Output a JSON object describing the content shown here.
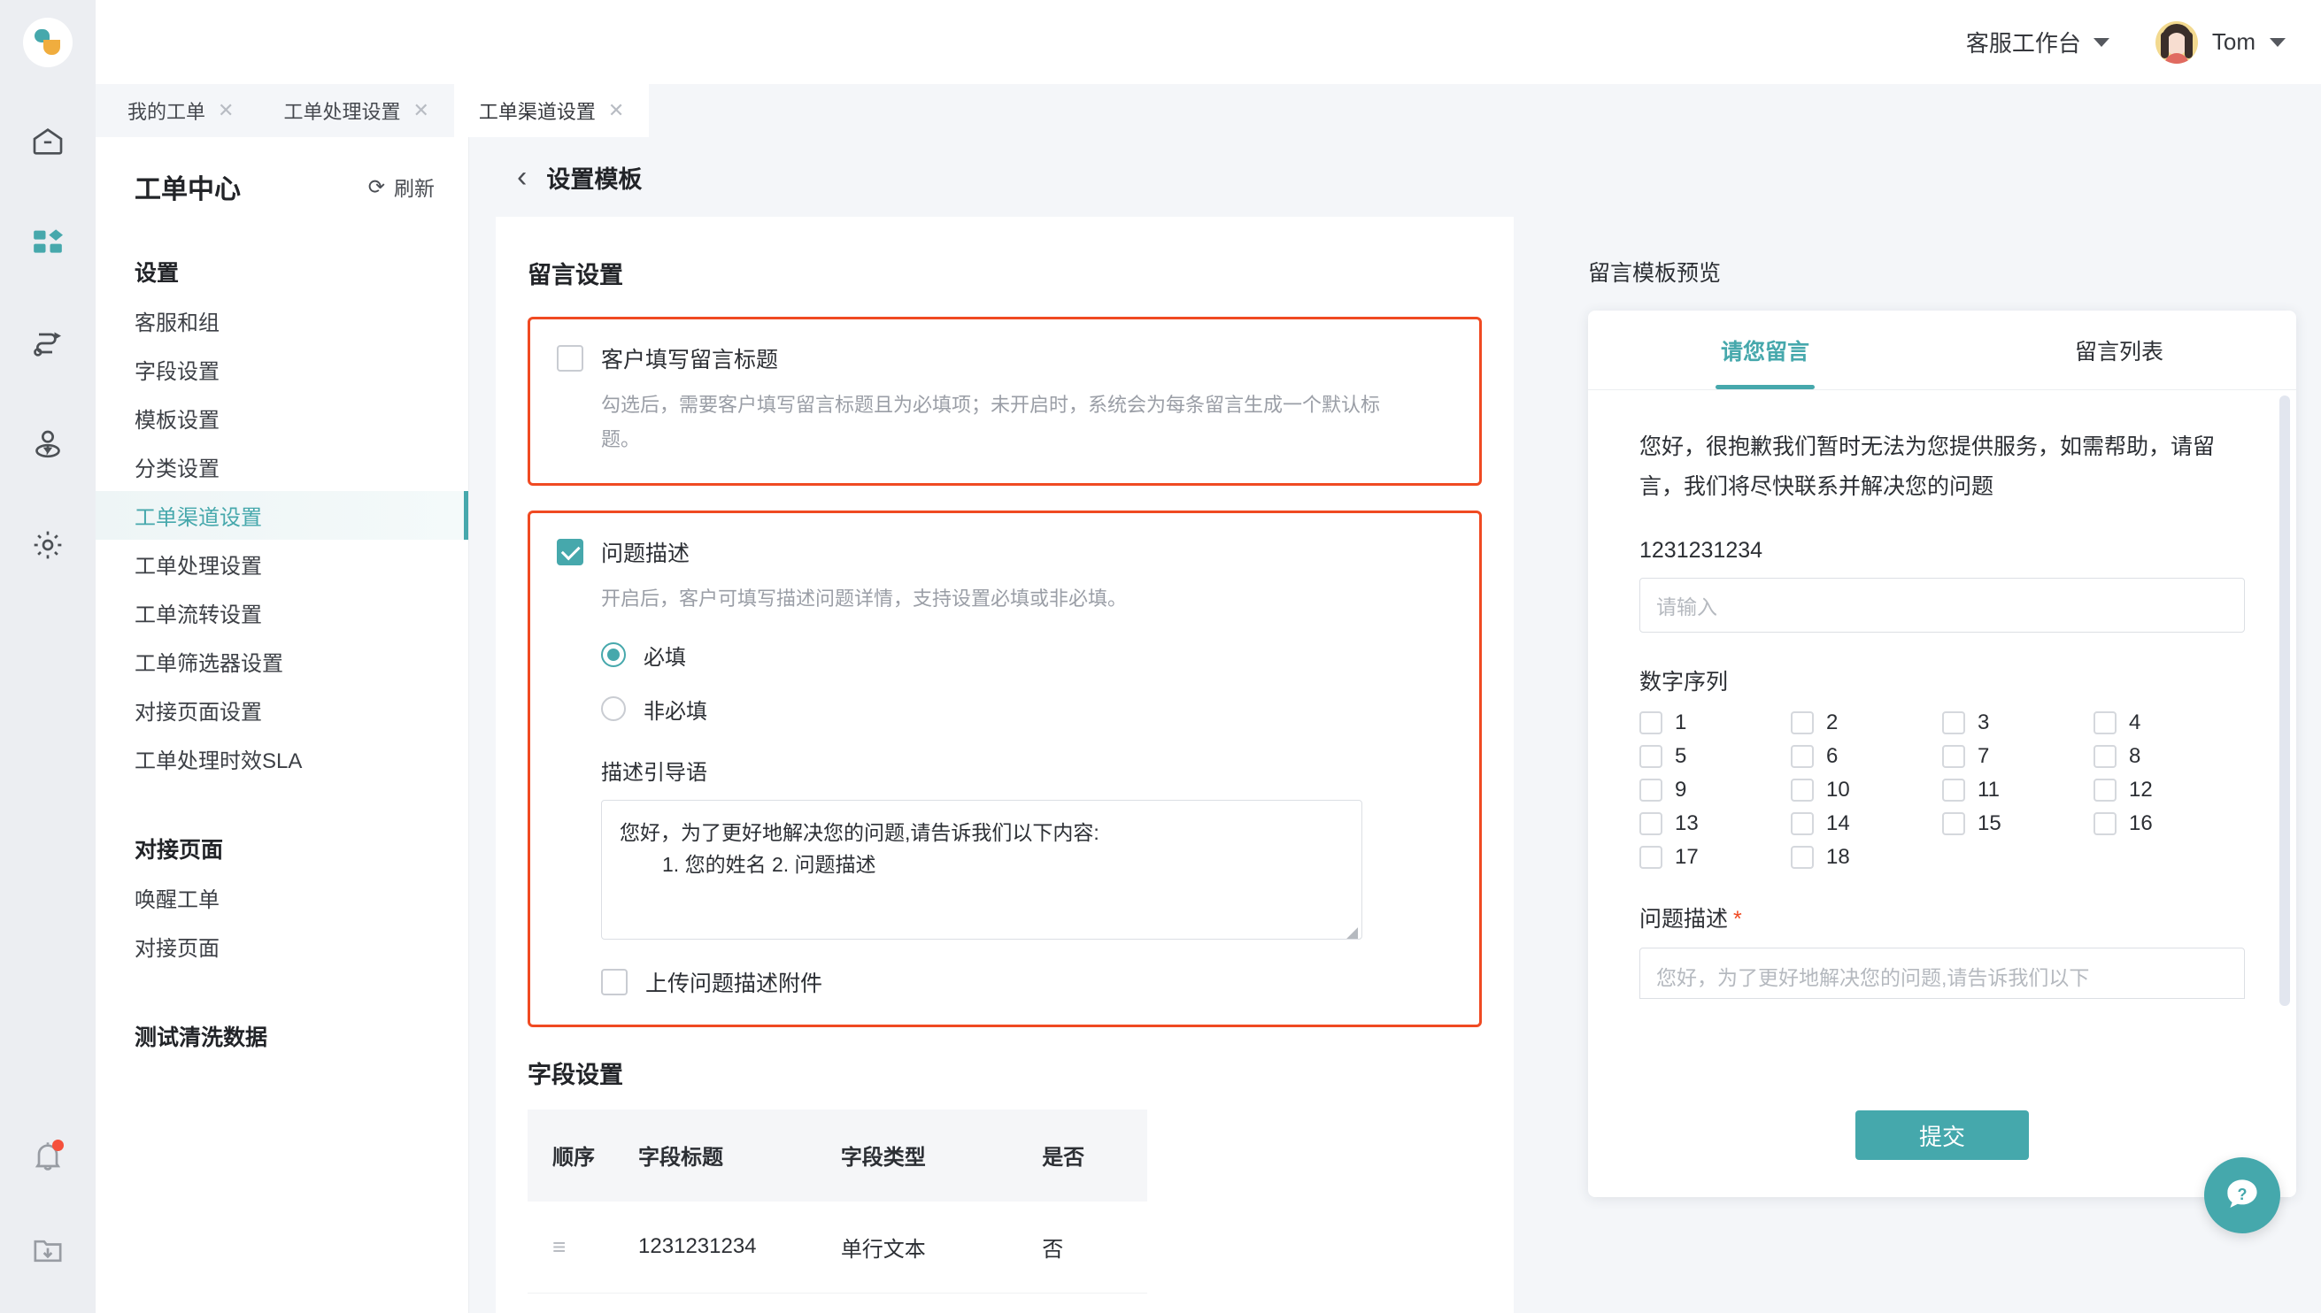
{
  "rail": {
    "logo_name": "app-logo",
    "icons": [
      {
        "name": "home-icon"
      },
      {
        "name": "apps-grid-icon"
      },
      {
        "name": "workflow-icon"
      },
      {
        "name": "customer-location-icon"
      },
      {
        "name": "gear-icon"
      }
    ],
    "bottom_icons": [
      {
        "name": "bell-icon",
        "badge": true
      },
      {
        "name": "download-folder-icon"
      }
    ]
  },
  "topbar": {
    "workbench_label": "客服工作台",
    "user_name": "Tom"
  },
  "tabs": [
    {
      "label": "我的工单",
      "active": false
    },
    {
      "label": "工单处理设置",
      "active": false
    },
    {
      "label": "工单渠道设置",
      "active": true
    }
  ],
  "tab_close_glyph": "✕",
  "menu": {
    "title": "工单中心",
    "refresh_label": "刷新",
    "refresh_icon_glyph": "⟳",
    "groups": [
      {
        "title": "设置",
        "items": [
          {
            "label": "客服和组",
            "active": false
          },
          {
            "label": "字段设置",
            "active": false
          },
          {
            "label": "模板设置",
            "active": false
          },
          {
            "label": "分类设置",
            "active": false
          },
          {
            "label": "工单渠道设置",
            "active": true
          },
          {
            "label": "工单处理设置",
            "active": false
          },
          {
            "label": "工单流转设置",
            "active": false
          },
          {
            "label": "工单筛选器设置",
            "active": false
          },
          {
            "label": "对接页面设置",
            "active": false
          },
          {
            "label": "工单处理时效SLA",
            "active": false
          }
        ]
      },
      {
        "title": "对接页面",
        "items": [
          {
            "label": "唤醒工单",
            "active": false
          },
          {
            "label": "对接页面",
            "active": false
          }
        ]
      },
      {
        "title": "测试清洗数据",
        "items": []
      }
    ]
  },
  "content": {
    "back_glyph": "‹",
    "title": "设置模板",
    "section_title": "留言设置",
    "box_title": {
      "checkbox_label": "客户填写留言标题",
      "checked": false,
      "hint": "勾选后，需要客户填写留言标题且为必填项；未开启时，系统会为每条留言生成一个默认标题。"
    },
    "box_desc": {
      "checkbox_label": "问题描述",
      "checked": true,
      "hint": "开启后，客户可填写描述问题详情，支持设置必填或非必填。",
      "radios": [
        {
          "label": "必填",
          "selected": true
        },
        {
          "label": "非必填",
          "selected": false
        }
      ],
      "guide_label": "描述引导语",
      "guide_line1": "您好，为了更好地解决您的问题,请告诉我们以下内容:",
      "guide_line2": "1. 您的姓名 2. 问题描述",
      "attach_label": "上传问题描述附件",
      "attach_checked": false
    },
    "fields_section": {
      "title": "字段设置",
      "columns": [
        "顺序",
        "字段标题",
        "字段类型",
        "是否"
      ],
      "rows": [
        {
          "order_glyph": "≡",
          "title": "1231231234",
          "type": "单行文本",
          "required": "否"
        }
      ]
    }
  },
  "preview": {
    "title": "留言模板预览",
    "tabs": [
      {
        "label": "请您留言",
        "active": true
      },
      {
        "label": "留言列表",
        "active": false
      }
    ],
    "greeting": "您好，很抱歉我们暂时无法为您提供服务，如需帮助，请留言，我们将尽快联系并解决您的问题",
    "field1_label": "1231231234",
    "field1_placeholder": "请输入",
    "numlist_label": "数字序列",
    "numlist_options": [
      "1",
      "2",
      "3",
      "4",
      "5",
      "6",
      "7",
      "8",
      "9",
      "10",
      "11",
      "12",
      "13",
      "14",
      "15",
      "16",
      "17",
      "18"
    ],
    "field2_label": "问题描述",
    "field2_required_mark": "*",
    "field2_placeholder": "您好，为了更好地解决您的问题,请告诉我们以下",
    "submit_label": "提交"
  },
  "help": {
    "name": "help-question-icon"
  },
  "colors": {
    "accent_teal": "#46a8ac",
    "highlight_red": "#f04a22",
    "badge_red": "#f5503c",
    "logo_amber": "#f0ad3e"
  }
}
